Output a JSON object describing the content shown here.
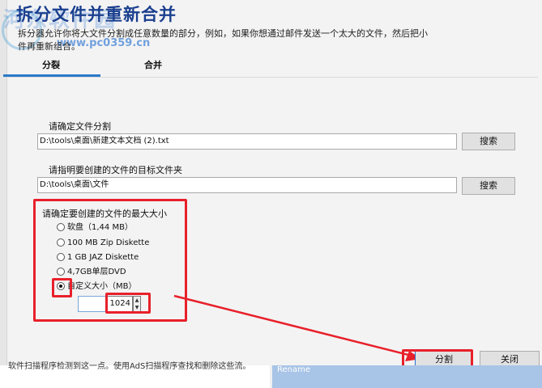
{
  "window": {
    "title": "拆分文件并重新合并",
    "description": "拆分器允许你将大文件分割成任意数量的部分，例如，如果你想通过邮件发送一个太大的文件，然后把小",
    "description2": "件再重新组合。",
    "watermark_text": "河东软件园",
    "watermark_url": "www.pc0359.cn"
  },
  "tabs": [
    {
      "label": "分裂",
      "active": true
    },
    {
      "label": "合并",
      "active": false
    }
  ],
  "split": {
    "source_label": "请确定文件分割",
    "source_value": "D:\\tools\\桌面\\新建文本文档 (2).txt",
    "source_browse": "搜索",
    "target_label": "请指明要创建的文件的目标文件夹",
    "target_value": "D:\\tools\\桌面\\文件",
    "target_browse": "搜索",
    "size_label": "请确定要创建的文件的最大大小",
    "size_options": [
      {
        "label": "软盘（1,44 MB）",
        "selected": false
      },
      {
        "label": "100 MB Zip Diskette",
        "selected": false
      },
      {
        "label": "1 GB JAZ Diskette",
        "selected": false
      },
      {
        "label": "4,7GB单层DVD",
        "selected": false
      },
      {
        "label": "自定义大小（MB）",
        "selected": true
      }
    ],
    "custom_size": "1024"
  },
  "buttons": {
    "split": "分割",
    "close": "关闭"
  },
  "background": {
    "left_text": "软件扫描程序检测到这一点。使用AdS扫描程序查找和删除这些流。",
    "right_text": "Rename"
  },
  "colors": {
    "accent": "#2b79c9",
    "highlight_red": "#e8202a",
    "title_blue": "#1a3f8f"
  }
}
